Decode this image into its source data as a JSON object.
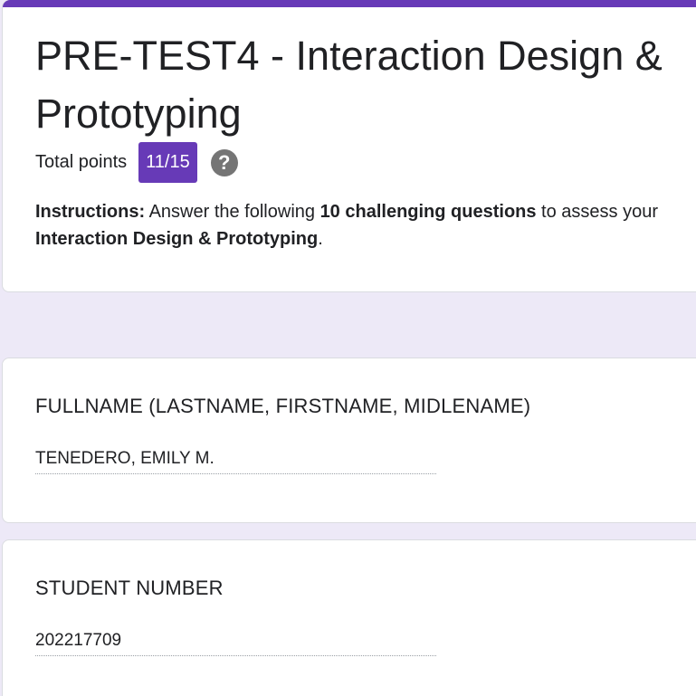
{
  "form": {
    "title": "PRE-TEST4 - Interaction Design & Prototyping",
    "accent_color": "#673ab7",
    "total_points_label": "Total points",
    "score": "11/15",
    "help_icon": "question-circle-icon",
    "instructions": {
      "label": "Instructions:",
      "text_1": " Answer the following ",
      "bold_1": "10 challenging questions",
      "text_2": " to assess your",
      "bold_2": "Interaction Design & Prototyping",
      "text_3": "."
    }
  },
  "questions": [
    {
      "title": "FULLNAME (LASTNAME, FIRSTNAME, MIDLENAME)",
      "answer": "TENEDERO, EMILY M."
    },
    {
      "title": "STUDENT NUMBER",
      "answer": "202217709"
    }
  ]
}
